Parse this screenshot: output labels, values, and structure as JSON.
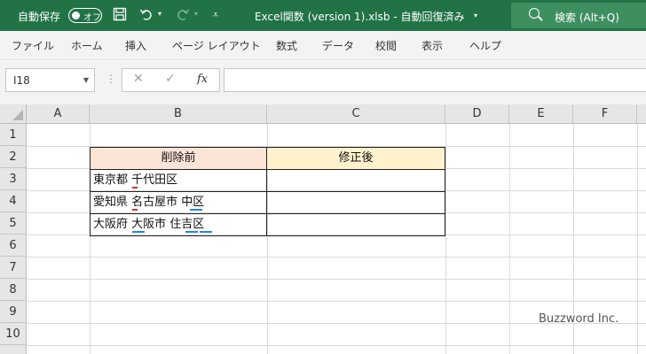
{
  "titlebar": {
    "autosave_label": "自動保存",
    "autosave_state": "オフ",
    "document_title": "Excel関数 (version 1).xlsb  -  自動回復済み",
    "search_text": "検索 (Alt+Q)",
    "qa_save_icon": "save-icon",
    "qa_undo_icon": "undo-icon",
    "qa_redo_icon": "redo-icon",
    "customize_icon": "customize-qat-icon"
  },
  "ribbon": {
    "tabs": [
      "ファイル",
      "ホーム",
      "挿入",
      "ページ レイアウト",
      "数式",
      "データ",
      "校閲",
      "表示",
      "ヘルプ"
    ]
  },
  "formula_bar": {
    "name_box": "I18",
    "cancel_glyph": "✕",
    "enter_glyph": "✓",
    "fx_label": "fx",
    "formula_value": ""
  },
  "sheet": {
    "columns": [
      "A",
      "B",
      "C",
      "D",
      "E",
      "F"
    ],
    "rows": [
      "1",
      "2",
      "3",
      "4",
      "5",
      "6",
      "7",
      "8",
      "9",
      "10"
    ],
    "header_b": "削除前",
    "header_c": "修正後",
    "b3": "東京都 千代田区",
    "b4": "愛知県 名古屋市  中区",
    "b5": "大阪府  大阪市    住吉区",
    "c3": "",
    "c4": "",
    "c5": "",
    "colors": {
      "header_b_fill": "#fce4d6",
      "header_c_fill": "#fff2cc",
      "halfwidth_space_mark": "#d32f2f",
      "fullwidth_space_mark": "#1e88e5"
    }
  },
  "watermark": "Buzzword Inc."
}
